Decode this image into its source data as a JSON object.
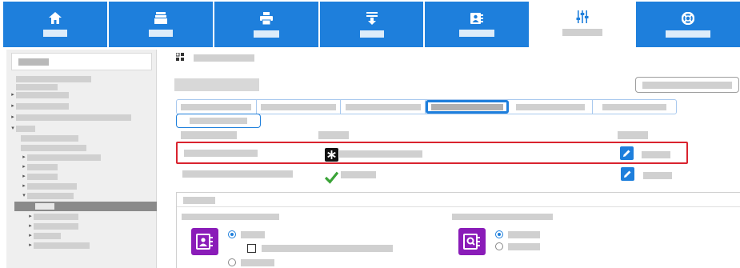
{
  "top_nav": {
    "tabs": [
      {
        "icon": "home-icon",
        "active": false
      },
      {
        "icon": "server-stack-icon",
        "active": false
      },
      {
        "icon": "printer-icon",
        "active": false
      },
      {
        "icon": "download-icon",
        "active": false
      },
      {
        "icon": "address-book-icon",
        "active": false
      },
      {
        "icon": "sliders-icon",
        "active": true
      },
      {
        "icon": "lifebuoy-icon",
        "active": false
      }
    ],
    "accent_color": "#1e7fdc"
  },
  "content": {
    "highlight_color": "#d9232e",
    "status_ok_color": "#3aa337",
    "address_icon_color": "#8a1cb8"
  }
}
